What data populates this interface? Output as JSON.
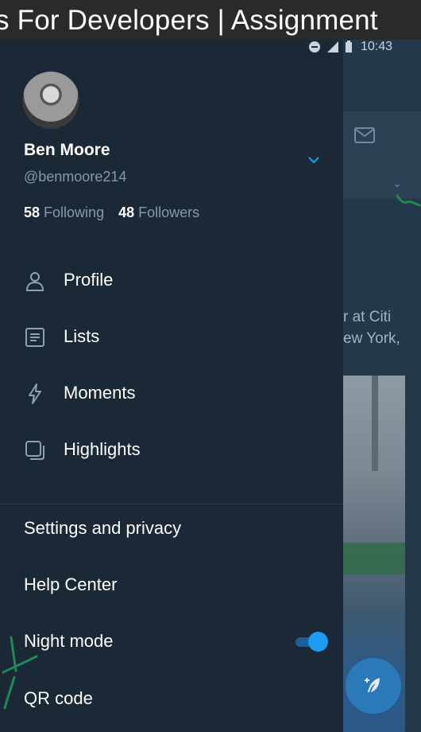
{
  "banner": {
    "title": "s For Developers | Assignment"
  },
  "status_bar": {
    "time": "10:43"
  },
  "background_app": {
    "tweet_snippet_line1": "r at Citi",
    "tweet_snippet_line2": "ew York,"
  },
  "account": {
    "name": "Ben Moore",
    "handle": "@benmoore214",
    "following_count": "58",
    "following_label": "Following",
    "followers_count": "48",
    "followers_label": "Followers"
  },
  "menu": {
    "items": [
      {
        "label": "Profile",
        "icon": "person-icon"
      },
      {
        "label": "Lists",
        "icon": "list-icon"
      },
      {
        "label": "Moments",
        "icon": "lightning-icon"
      },
      {
        "label": "Highlights",
        "icon": "highlights-icon"
      }
    ]
  },
  "links": {
    "settings": "Settings and privacy",
    "help": "Help Center",
    "night_mode": "Night mode",
    "qr_code": "QR code"
  },
  "night_mode_enabled": true,
  "colors": {
    "accent": "#1d9bf0",
    "drawer_bg": "#1b2836",
    "secondary_text": "#8699aa"
  }
}
